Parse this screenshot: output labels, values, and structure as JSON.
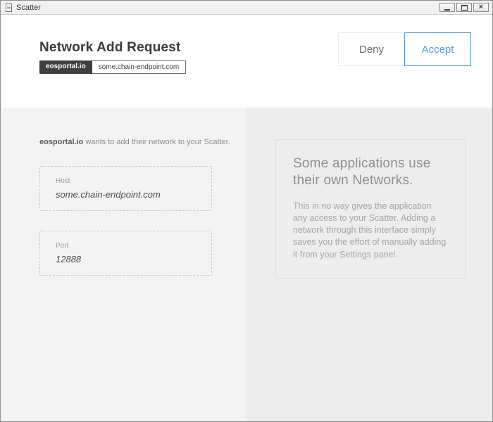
{
  "window": {
    "title": "Scatter",
    "controls": {
      "minimize": "minimize",
      "maximize": "maximize",
      "close": "close"
    }
  },
  "header": {
    "title": "Network Add Request",
    "app_badge": "eosportal.io",
    "endpoint": "some.chain-endpoint.com",
    "actions": {
      "deny": "Deny",
      "accept": "Accept"
    }
  },
  "request": {
    "intro_app": "eosportal.io",
    "intro_text": " wants to add their network to your Scatter.",
    "fields": [
      {
        "label": "Host",
        "value": "some.chain-endpoint.com"
      },
      {
        "label": "Port",
        "value": "12888"
      }
    ]
  },
  "info": {
    "title": "Some applications use their own Networks.",
    "body": "This in no way gives the application any access to your Scatter. Adding a network through this interface simply saves you the effort of manually adding it from your Settings panel."
  },
  "colors": {
    "accent_blue": "#4f9bd8",
    "badge_bg": "#3f3f3f",
    "panel_left_bg": "#f3f3f3",
    "panel_right_bg": "#ededed"
  }
}
